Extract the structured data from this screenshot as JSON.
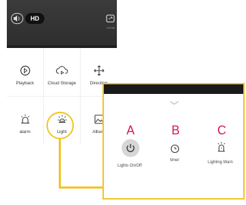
{
  "video": {
    "quality_label": "HD",
    "fullscreen_caption": "ZOOM"
  },
  "features": [
    {
      "label": "Playback",
      "icon": "play-circle-icon"
    },
    {
      "label": "Cloud Storage",
      "icon": "cloud-play-icon"
    },
    {
      "label": "Direction",
      "icon": "move-arrows-icon"
    },
    {
      "label": "alarm",
      "icon": "alarm-icon"
    },
    {
      "label": "Light",
      "icon": "sun-icon"
    },
    {
      "label": "Album",
      "icon": "image-icon"
    }
  ],
  "light_panel": {
    "options": [
      {
        "marker": "A",
        "label": "Lights On/Off",
        "icon": "power-icon"
      },
      {
        "marker": "B",
        "label": "timer",
        "icon": "clock-icon"
      },
      {
        "marker": "C",
        "label": "Lighting Warn",
        "icon": "siren-icon"
      }
    ]
  },
  "colors": {
    "highlight": "#f2c31e",
    "marker": "#d11a5a"
  }
}
